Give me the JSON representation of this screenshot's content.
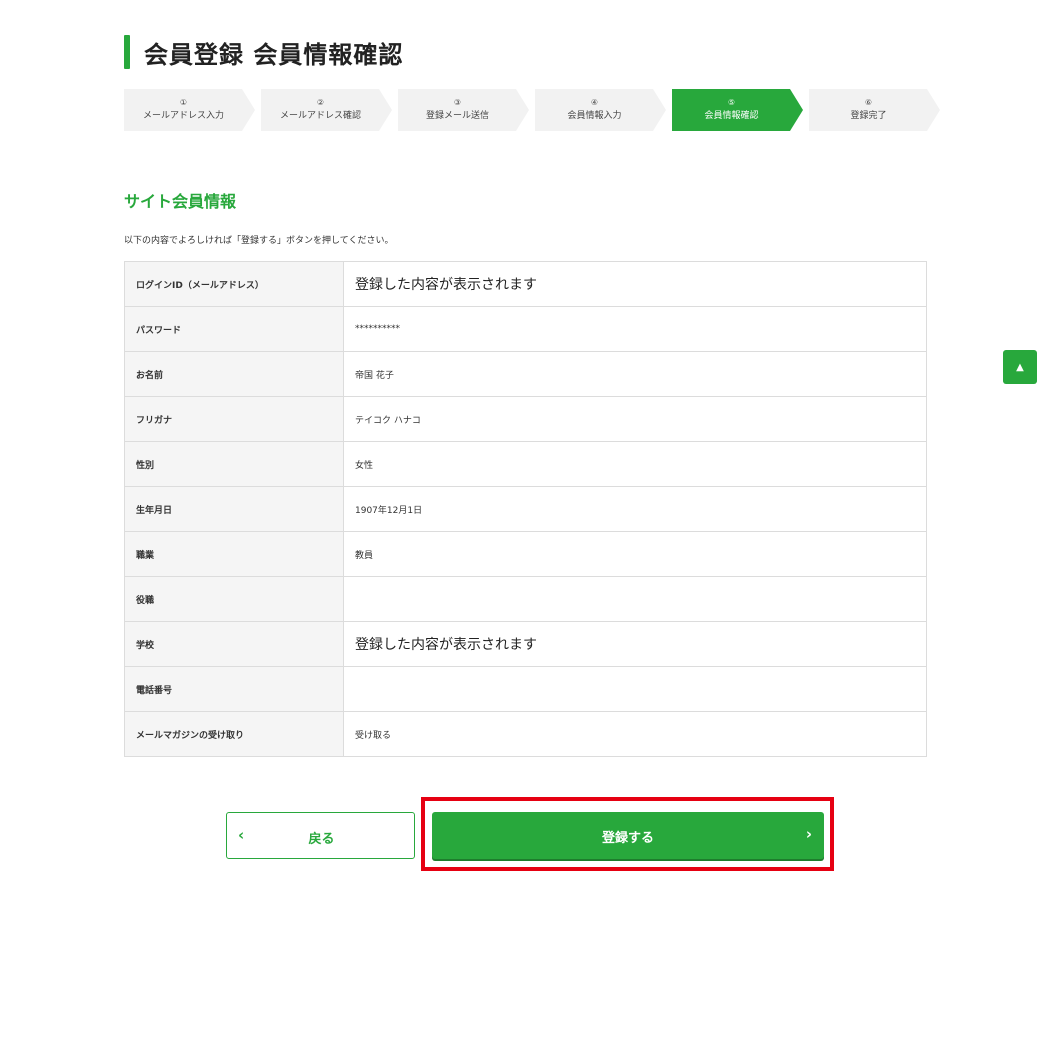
{
  "page": {
    "title": "会員登録 会員情報確認"
  },
  "colors": {
    "accent": "#28a83c",
    "highlight": "#e60012"
  },
  "steps": [
    {
      "num": "①",
      "label": "メールアドレス入力"
    },
    {
      "num": "②",
      "label": "メールアドレス確認"
    },
    {
      "num": "③",
      "label": "登録メール送信"
    },
    {
      "num": "④",
      "label": "会員情報入力"
    },
    {
      "num": "⑤",
      "label": "会員情報確認"
    },
    {
      "num": "⑥",
      "label": "登録完了"
    }
  ],
  "active_step": "⑤",
  "section": {
    "title": "サイト会員情報",
    "instruction": "以下の内容でよろしければ「登録する」ボタンを押してください。"
  },
  "rows": [
    {
      "label": "ログインID（メールアドレス）",
      "value": "登録した内容が表示されます"
    },
    {
      "label": "パスワード",
      "value": "**********"
    },
    {
      "label": "お名前",
      "value": "帝国 花子"
    },
    {
      "label": "フリガナ",
      "value": "テイコク ハナコ"
    },
    {
      "label": "性別",
      "value": "女性"
    },
    {
      "label": "生年月日",
      "value": "1907年12月1日"
    },
    {
      "label": "職業",
      "value": "教員"
    },
    {
      "label": "役職",
      "value": ""
    },
    {
      "label": "学校",
      "value": "登録した内容が表示されます"
    },
    {
      "label": "電話番号",
      "value": ""
    },
    {
      "label": "メールマガジンの受け取り",
      "value": "受け取る"
    }
  ],
  "buttons": {
    "back_label": "戻る",
    "submit_label": "登録する",
    "back_icon": "chevron-left-icon",
    "submit_icon": "chevron-right-icon",
    "scroll_top_icon": "arrow-up-icon"
  }
}
